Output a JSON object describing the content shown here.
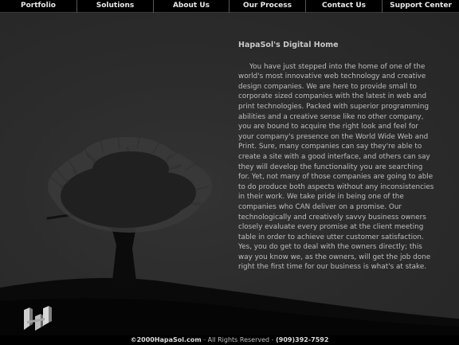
{
  "nav": {
    "items": [
      {
        "label": "Portfolio"
      },
      {
        "label": "Solutions"
      },
      {
        "label": "About Us"
      },
      {
        "label": "Our Process"
      },
      {
        "label": "Contact Us"
      },
      {
        "label": "Support Center"
      }
    ]
  },
  "main": {
    "heading": "HapaSol's Digital Home",
    "body": "You have just stepped into the home of one of the world's most innovative web technology and creative design companies. We are here to provide small to corporate sized companies with the latest in web and print technologies. Packed with superior programming abilities and a creative sense like no other company, you are bound to acquire the right look and feel for your company's presence on the World Wide Web and Print. Sure, many companies can say they're able to create a site with a good interface, and others can say they will develop the functionality you are searching for. Yet, not many of those companies are going to able to do produce both aspects without any inconsistencies in their work. We take pride in being one of the companies who CAN deliver on a promise. Our technologically and creatively savvy business owners closely evaluate every promise at the client meeting table in order to achieve utter customer satisfaction. Yes, you do get to deal with the owners directly; this way you know we, as the owners, will get the job done right the first time for our business is what's at stake."
  },
  "footer": {
    "copyright": "©2000HapaSol.com",
    "separator1": " - ",
    "rights": "All Rights Reserved",
    "separator2": " - ",
    "phone": "(909)392-7592"
  },
  "colors": {
    "background": "#2b2b2b",
    "nav_bar": "#000000",
    "text": "#bdbdbd"
  },
  "icons": {
    "logo": "hapasol-logo-icon",
    "tree": "tree-illustration"
  }
}
